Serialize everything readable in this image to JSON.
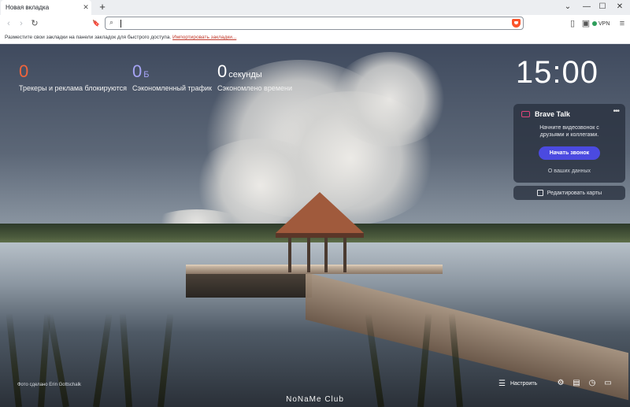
{
  "tab": {
    "title": "Новая вкладка",
    "close_glyph": "✕",
    "new_tab_glyph": "+"
  },
  "window_controls": {
    "minimize": "—",
    "maximize": "☐",
    "close": "✕",
    "tab_list": "⌄"
  },
  "toolbar": {
    "back_glyph": "‹",
    "forward_glyph": "›",
    "reload_glyph": "↻",
    "bookmark_glyph": "🔖",
    "search_glyph": "⌕",
    "sidebar_glyph": "▯",
    "wallet_glyph": "▣",
    "vpn_label": "VPN",
    "menu_glyph": "≡"
  },
  "url_bar": {
    "value": ""
  },
  "bookmarks_bar": {
    "prompt": "Разместите свои закладки на панели закладок для быстрого доступа.",
    "import_link": "Импортировать закладки..."
  },
  "stats": [
    {
      "value": "0",
      "unit": "",
      "label": "Трекеры и реклама блокируются",
      "color": "#f0643c"
    },
    {
      "value": "0",
      "unit": "Б",
      "label": "Сэкономленный трафик",
      "color": "#a6a4f5"
    },
    {
      "value": "0",
      "unit": "секунды",
      "label": "Сэкономлено времени",
      "color": "#ffffff"
    }
  ],
  "clock": {
    "time": "15:00"
  },
  "brave_talk": {
    "title": "Brave Talk",
    "more_glyph": "•••",
    "description": "Начните видеозвонок с друзьями и коллегами.",
    "start_button": "Начать звонок",
    "privacy_link": "О ваших данных"
  },
  "edit_cards": {
    "label": "Редактировать карты"
  },
  "footer": {
    "photo_credit": "Фото сделано Erin Gottschalk",
    "watermark": "NoNaMe Club",
    "customize_glyph": "☰",
    "customize_label": "Настроить",
    "settings_glyph": "⚙",
    "bookmarks_glyph": "▤",
    "history_glyph": "◷",
    "talk_glyph": "▭"
  },
  "colors": {
    "accent_button": "#4b4ae0",
    "brave_orange": "#fb542b",
    "talk_pink": "#e1457a"
  }
}
